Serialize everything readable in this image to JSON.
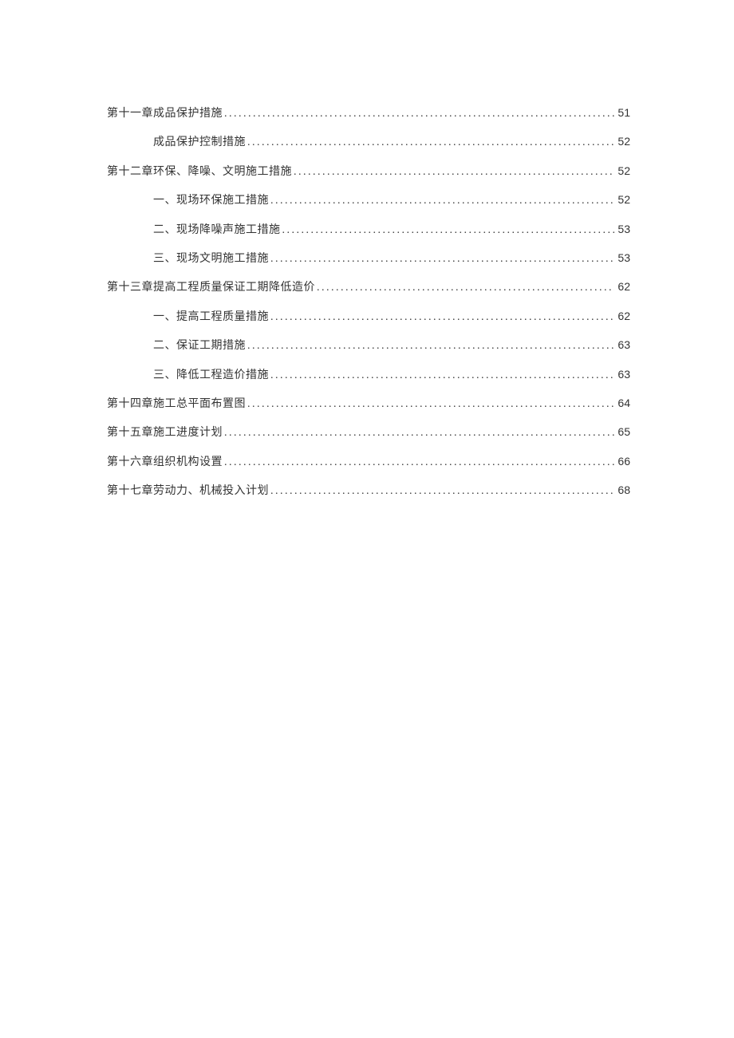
{
  "toc": [
    {
      "level": 1,
      "title": "第十一章成品保护措施",
      "page": "51"
    },
    {
      "level": 2,
      "title": "成品保护控制措施",
      "page": "52"
    },
    {
      "level": 1,
      "title": "第十二章环保、降噪、文明施工措施",
      "page": "52"
    },
    {
      "level": 2,
      "title": "一、现场环保施工措施",
      "page": "52"
    },
    {
      "level": 2,
      "title": "二、现场降噪声施工措施",
      "page": "53"
    },
    {
      "level": 2,
      "title": "三、现场文明施工措施",
      "page": "53"
    },
    {
      "level": 1,
      "title": "第十三章提高工程质量保证工期降低造价",
      "page": "62"
    },
    {
      "level": 2,
      "title": "一、提高工程质量措施",
      "page": "62"
    },
    {
      "level": 2,
      "title": "二、保证工期措施",
      "page": "63"
    },
    {
      "level": 2,
      "title": "三、降低工程造价措施",
      "page": "63"
    },
    {
      "level": 1,
      "title": "第十四章施工总平面布置图",
      "page": "64"
    },
    {
      "level": 1,
      "title": "第十五章施工进度计划",
      "page": "65"
    },
    {
      "level": 1,
      "title": "第十六章组织机构设置",
      "page": "66"
    },
    {
      "level": 1,
      "title": "第十七章劳动力、机械投入计划",
      "page": "68"
    }
  ]
}
